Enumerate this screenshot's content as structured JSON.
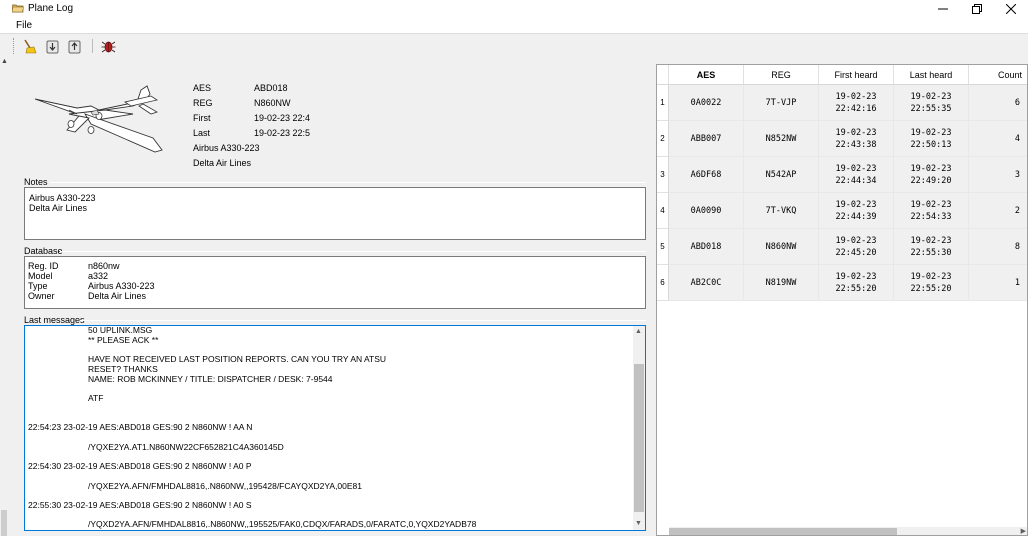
{
  "window": {
    "title": "Plane Log"
  },
  "menu": {
    "file": "File"
  },
  "toolbar": {
    "icons": [
      "broom-icon",
      "download-icon",
      "upload-icon",
      "bug-icon"
    ]
  },
  "aircraft": {
    "aes_label": "AES",
    "aes_value": "ABD018",
    "reg_label": "REG",
    "reg_value": "N860NW",
    "first_label": "First",
    "first_value": "19-02-23 22:4",
    "last_label": "Last",
    "last_value": "19-02-23 22:5",
    "type": "Airbus A330-223",
    "owner": "Delta Air Lines"
  },
  "notes": {
    "title": "Notes",
    "line1": "Airbus A330-223",
    "line2": "Delta Air Lines"
  },
  "database": {
    "title": "Database",
    "rows": [
      {
        "key": "Reg. ID",
        "value": "n860nw"
      },
      {
        "key": "Model",
        "value": "a332"
      },
      {
        "key": "Type",
        "value": "Airbus A330-223"
      },
      {
        "key": "Owner",
        "value": "Delta Air Lines"
      }
    ]
  },
  "messages": {
    "title": "Last messages",
    "lines": [
      "50 UPLINK.MSG",
      "** PLEASE ACK **",
      "HAVE NOT RECEIVED LAST POSITION REPORTS. CAN YOU TRY AN ATSU",
      "RESET?  THANKS",
      "NAME: ROB MCKINNEY / TITLE: DISPATCHER / DESK: 7-9544",
      "ATF",
      "22:54:23 23-02-19 AES:ABD018 GES:90 2 N860NW ! AA N",
      "/YQXE2YA.AT1.N860NW22CF652821C4A360145D",
      "22:54:30 23-02-19 AES:ABD018 GES:90 2 N860NW ! A0 P",
      "/YQXE2YA.AFN/FMHDAL8816,.N860NW,,195428/FCAYQXD2YA,00E81",
      "22:55:30 23-02-19 AES:ABD018 GES:90 2 N860NW ! A0 S",
      "/YQXD2YA.AFN/FMHDAL8816,.N860NW,,195525/FAK0,CDQX/FARADS,0/FARATC,0,YQXD2YADB78"
    ]
  },
  "table": {
    "headers": [
      "AES",
      "REG",
      "First heard",
      "Last heard",
      "Count"
    ],
    "rows": [
      {
        "n": "1",
        "aes": "0A0022",
        "reg": "7T-VJP",
        "first_d": "19-02-23",
        "first_t": "22:42:16",
        "last_d": "19-02-23",
        "last_t": "22:55:35",
        "count": "6"
      },
      {
        "n": "2",
        "aes": "ABB007",
        "reg": "N852NW",
        "first_d": "19-02-23",
        "first_t": "22:43:38",
        "last_d": "19-02-23",
        "last_t": "22:50:13",
        "count": "4"
      },
      {
        "n": "3",
        "aes": "A6DF68",
        "reg": "N542AP",
        "first_d": "19-02-23",
        "first_t": "22:44:34",
        "last_d": "19-02-23",
        "last_t": "22:49:20",
        "count": "3"
      },
      {
        "n": "4",
        "aes": "0A0090",
        "reg": "7T-VKQ",
        "first_d": "19-02-23",
        "first_t": "22:44:39",
        "last_d": "19-02-23",
        "last_t": "22:54:33",
        "count": "2"
      },
      {
        "n": "5",
        "aes": "ABD018",
        "reg": "N860NW",
        "first_d": "19-02-23",
        "first_t": "22:45:20",
        "last_d": "19-02-23",
        "last_t": "22:55:30",
        "count": "8"
      },
      {
        "n": "6",
        "aes": "AB2C0C",
        "reg": "N819NW",
        "first_d": "19-02-23",
        "first_t": "22:55:20",
        "last_d": "19-02-23",
        "last_t": "22:55:20",
        "count": "1"
      }
    ]
  },
  "colors": {
    "selection_border": "#0078d7",
    "background": "#f0f0f0"
  }
}
